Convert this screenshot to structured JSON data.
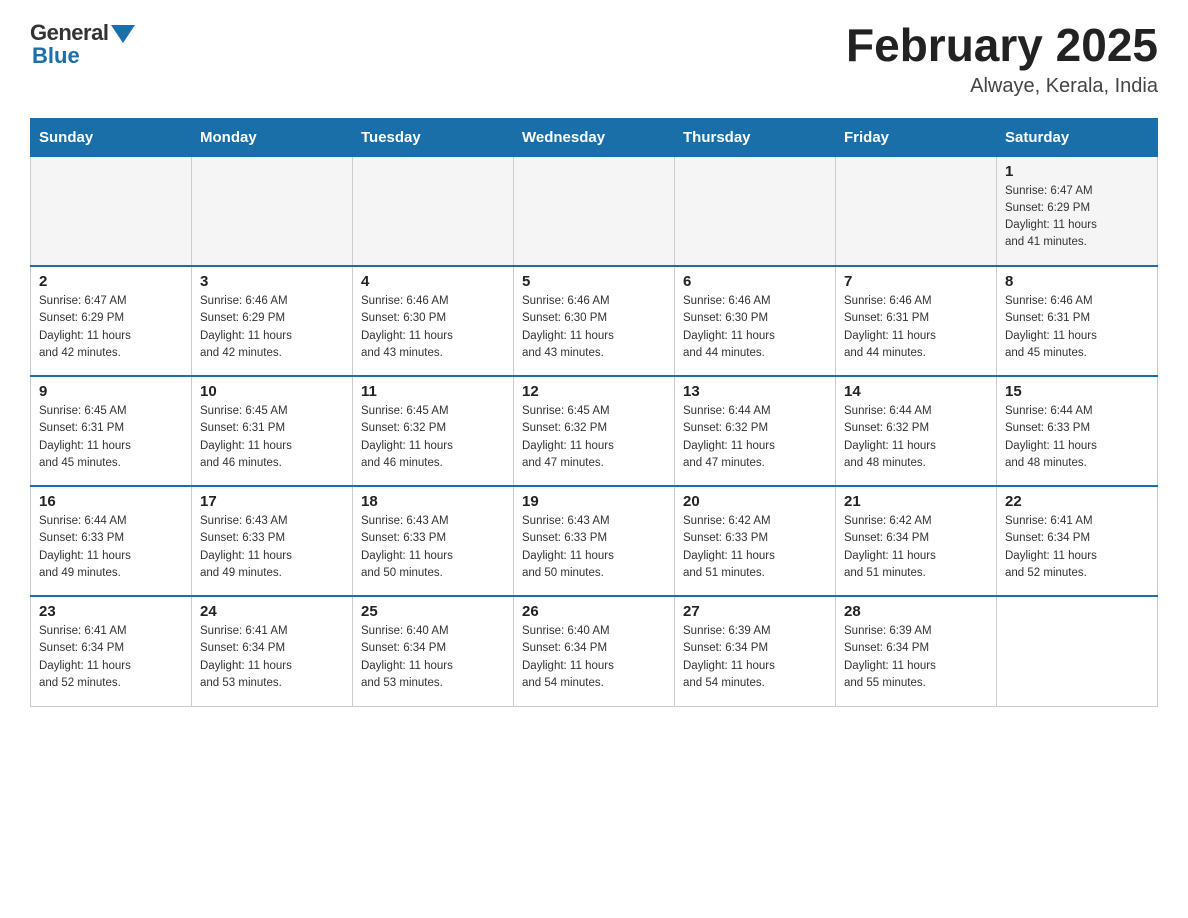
{
  "header": {
    "logo_general": "General",
    "logo_blue": "Blue",
    "month_title": "February 2025",
    "location": "Alwaye, Kerala, India"
  },
  "days_of_week": [
    "Sunday",
    "Monday",
    "Tuesday",
    "Wednesday",
    "Thursday",
    "Friday",
    "Saturday"
  ],
  "weeks": [
    [
      {
        "day": "",
        "info": ""
      },
      {
        "day": "",
        "info": ""
      },
      {
        "day": "",
        "info": ""
      },
      {
        "day": "",
        "info": ""
      },
      {
        "day": "",
        "info": ""
      },
      {
        "day": "",
        "info": ""
      },
      {
        "day": "1",
        "info": "Sunrise: 6:47 AM\nSunset: 6:29 PM\nDaylight: 11 hours\nand 41 minutes."
      }
    ],
    [
      {
        "day": "2",
        "info": "Sunrise: 6:47 AM\nSunset: 6:29 PM\nDaylight: 11 hours\nand 42 minutes."
      },
      {
        "day": "3",
        "info": "Sunrise: 6:46 AM\nSunset: 6:29 PM\nDaylight: 11 hours\nand 42 minutes."
      },
      {
        "day": "4",
        "info": "Sunrise: 6:46 AM\nSunset: 6:30 PM\nDaylight: 11 hours\nand 43 minutes."
      },
      {
        "day": "5",
        "info": "Sunrise: 6:46 AM\nSunset: 6:30 PM\nDaylight: 11 hours\nand 43 minutes."
      },
      {
        "day": "6",
        "info": "Sunrise: 6:46 AM\nSunset: 6:30 PM\nDaylight: 11 hours\nand 44 minutes."
      },
      {
        "day": "7",
        "info": "Sunrise: 6:46 AM\nSunset: 6:31 PM\nDaylight: 11 hours\nand 44 minutes."
      },
      {
        "day": "8",
        "info": "Sunrise: 6:46 AM\nSunset: 6:31 PM\nDaylight: 11 hours\nand 45 minutes."
      }
    ],
    [
      {
        "day": "9",
        "info": "Sunrise: 6:45 AM\nSunset: 6:31 PM\nDaylight: 11 hours\nand 45 minutes."
      },
      {
        "day": "10",
        "info": "Sunrise: 6:45 AM\nSunset: 6:31 PM\nDaylight: 11 hours\nand 46 minutes."
      },
      {
        "day": "11",
        "info": "Sunrise: 6:45 AM\nSunset: 6:32 PM\nDaylight: 11 hours\nand 46 minutes."
      },
      {
        "day": "12",
        "info": "Sunrise: 6:45 AM\nSunset: 6:32 PM\nDaylight: 11 hours\nand 47 minutes."
      },
      {
        "day": "13",
        "info": "Sunrise: 6:44 AM\nSunset: 6:32 PM\nDaylight: 11 hours\nand 47 minutes."
      },
      {
        "day": "14",
        "info": "Sunrise: 6:44 AM\nSunset: 6:32 PM\nDaylight: 11 hours\nand 48 minutes."
      },
      {
        "day": "15",
        "info": "Sunrise: 6:44 AM\nSunset: 6:33 PM\nDaylight: 11 hours\nand 48 minutes."
      }
    ],
    [
      {
        "day": "16",
        "info": "Sunrise: 6:44 AM\nSunset: 6:33 PM\nDaylight: 11 hours\nand 49 minutes."
      },
      {
        "day": "17",
        "info": "Sunrise: 6:43 AM\nSunset: 6:33 PM\nDaylight: 11 hours\nand 49 minutes."
      },
      {
        "day": "18",
        "info": "Sunrise: 6:43 AM\nSunset: 6:33 PM\nDaylight: 11 hours\nand 50 minutes."
      },
      {
        "day": "19",
        "info": "Sunrise: 6:43 AM\nSunset: 6:33 PM\nDaylight: 11 hours\nand 50 minutes."
      },
      {
        "day": "20",
        "info": "Sunrise: 6:42 AM\nSunset: 6:33 PM\nDaylight: 11 hours\nand 51 minutes."
      },
      {
        "day": "21",
        "info": "Sunrise: 6:42 AM\nSunset: 6:34 PM\nDaylight: 11 hours\nand 51 minutes."
      },
      {
        "day": "22",
        "info": "Sunrise: 6:41 AM\nSunset: 6:34 PM\nDaylight: 11 hours\nand 52 minutes."
      }
    ],
    [
      {
        "day": "23",
        "info": "Sunrise: 6:41 AM\nSunset: 6:34 PM\nDaylight: 11 hours\nand 52 minutes."
      },
      {
        "day": "24",
        "info": "Sunrise: 6:41 AM\nSunset: 6:34 PM\nDaylight: 11 hours\nand 53 minutes."
      },
      {
        "day": "25",
        "info": "Sunrise: 6:40 AM\nSunset: 6:34 PM\nDaylight: 11 hours\nand 53 minutes."
      },
      {
        "day": "26",
        "info": "Sunrise: 6:40 AM\nSunset: 6:34 PM\nDaylight: 11 hours\nand 54 minutes."
      },
      {
        "day": "27",
        "info": "Sunrise: 6:39 AM\nSunset: 6:34 PM\nDaylight: 11 hours\nand 54 minutes."
      },
      {
        "day": "28",
        "info": "Sunrise: 6:39 AM\nSunset: 6:34 PM\nDaylight: 11 hours\nand 55 minutes."
      },
      {
        "day": "",
        "info": ""
      }
    ]
  ]
}
